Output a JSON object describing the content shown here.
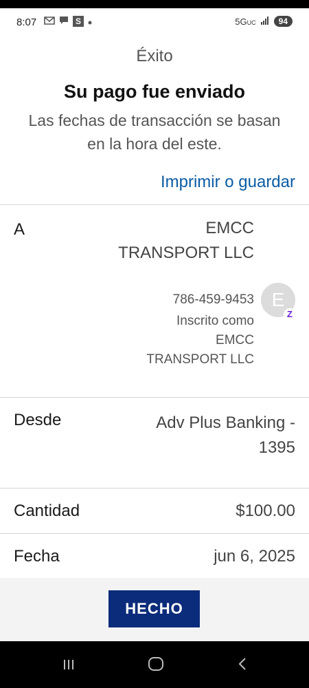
{
  "status_bar": {
    "time": "8:07",
    "left_icons": [
      "gmail-icon",
      "chat-icon",
      "s-app-icon",
      "dot-icon"
    ],
    "s_badge": "S",
    "network": "5G",
    "network_sub": "UC",
    "battery": "94"
  },
  "header": {
    "title": "Éxito"
  },
  "confirmation": {
    "title": "Su pago fue enviado",
    "subtitle": "Las fechas de transacción se basan en la hora del este."
  },
  "print_link": "Imprimir o guardar",
  "to": {
    "label": "A",
    "name": "EMCC TRANSPORT LLC",
    "phone": "786-459-9453",
    "enrolled": "Inscrito como EMCC TRANSPORT LLC",
    "avatar_letter": "E",
    "badge_letter": "Z"
  },
  "from": {
    "label": "Desde",
    "value": "Adv Plus Banking - 1395"
  },
  "amount": {
    "label": "Cantidad",
    "value": "$100.00"
  },
  "date": {
    "label": "Fecha",
    "value": "jun 6, 2025"
  },
  "done_button": "HECHO",
  "colors": {
    "link": "#0b5ba3",
    "button": "#0b2c7a",
    "zelle": "#6d1ed4"
  }
}
